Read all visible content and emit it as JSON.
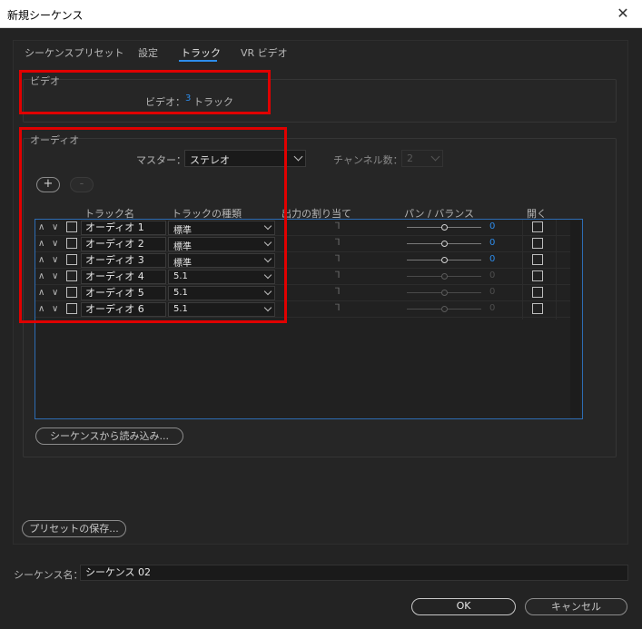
{
  "window": {
    "title": "新規シーケンス",
    "close_glyph": "✕"
  },
  "tabs": [
    {
      "label": "シーケンスプリセット"
    },
    {
      "label": "設定"
    },
    {
      "label": "トラック"
    },
    {
      "label": "VR ビデオ"
    }
  ],
  "video": {
    "group_title": "ビデオ",
    "label": "ビデオ：",
    "count": "3",
    "unit": "トラック"
  },
  "audio": {
    "group_title": "オーディオ",
    "master_label": "マスター：",
    "master_value": "ステレオ",
    "channels_label": "チャンネル数：",
    "channels_value": "2",
    "add_glyph": "+",
    "remove_glyph": "-",
    "columns": {
      "name": "トラック名",
      "type": "トラックの種類",
      "output": "出力の割り当て",
      "pan": "パン / バランス",
      "open": "開く"
    },
    "tracks": [
      {
        "name": "オーディオ 1",
        "type": "標準",
        "pan": "0",
        "active": true
      },
      {
        "name": "オーディオ 2",
        "type": "標準",
        "pan": "0",
        "active": true
      },
      {
        "name": "オーディオ 3",
        "type": "標準",
        "pan": "0",
        "active": true
      },
      {
        "name": "オーディオ 4",
        "type": "5.1",
        "pan": "0",
        "active": false
      },
      {
        "name": "オーディオ 5",
        "type": "5.1",
        "pan": "0",
        "active": false
      },
      {
        "name": "オーディオ 6",
        "type": "5.1",
        "pan": "0",
        "active": false
      }
    ],
    "import_button": "シーケンスから読み込み..."
  },
  "save_preset_button": "プリセットの保存...",
  "sequence_name": {
    "label": "シーケンス名：",
    "value": "シーケンス 02"
  },
  "ok_button": "OK",
  "cancel_button": "キャンセル",
  "colors": {
    "accent": "#2d8ceb",
    "highlight_box": "#e00000"
  }
}
